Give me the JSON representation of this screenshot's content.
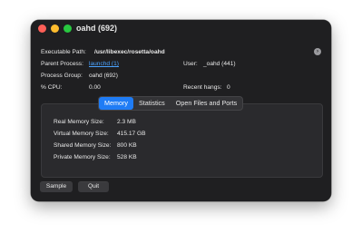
{
  "window": {
    "title": "oahd (692)"
  },
  "details": {
    "executable_path_label": "Executable Path:",
    "executable_path_value": "/usr/libexec/rosetta/oahd",
    "parent_process_label": "Parent Process:",
    "parent_process_value": "launchd (1)",
    "user_label": "User:",
    "user_value": "_oahd (441)",
    "process_group_label": "Process Group:",
    "process_group_value": "oahd (692)",
    "cpu_label": "% CPU:",
    "cpu_value": "0.00",
    "recent_hangs_label": "Recent hangs:",
    "recent_hangs_value": "0"
  },
  "tabs": [
    {
      "label": "Memory",
      "active": true
    },
    {
      "label": "Statistics",
      "active": false
    },
    {
      "label": "Open Files and Ports",
      "active": false
    }
  ],
  "memory": {
    "rows": [
      {
        "label": "Real Memory Size:",
        "value": "2.3 MB"
      },
      {
        "label": "Virtual Memory Size:",
        "value": "415.17 GB"
      },
      {
        "label": "Shared Memory Size:",
        "value": "800 KB"
      },
      {
        "label": "Private Memory Size:",
        "value": "528 KB"
      }
    ]
  },
  "buttons": {
    "sample": "Sample",
    "quit": "Quit"
  },
  "colors": {
    "accent": "#1f7cf5",
    "link": "#4aa3ff",
    "window_bg": "#1f1f21"
  }
}
